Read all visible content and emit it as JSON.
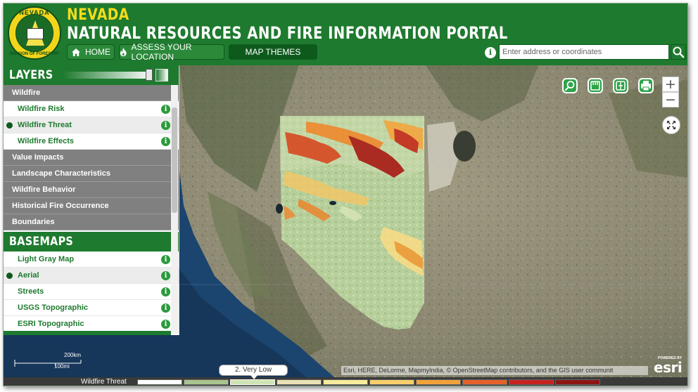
{
  "header": {
    "logo_text_top": "NEVADA",
    "logo_text_bottom": "DIVISION OF FORESTRY",
    "title_line1": "NEVADA",
    "title_line2": "NATURAL RESOURCES AND FIRE INFORMATION PORTAL"
  },
  "nav": {
    "home": {
      "label": "HOME",
      "icon": "home-icon"
    },
    "assess": {
      "label": "ASSESS YOUR LOCATION",
      "icon": "flame-icon"
    },
    "themes": {
      "label": "MAP THEMES"
    }
  },
  "search": {
    "placeholder": "Enter address or coordinates",
    "value": "",
    "info_icon": "info-icon",
    "button_icon": "search-icon"
  },
  "layers": {
    "title": "LAYERS",
    "groups": [
      {
        "label": "Wildfire",
        "items": [
          {
            "label": "Wildfire Risk",
            "selected": false
          },
          {
            "label": "Wildfire Threat",
            "selected": true
          },
          {
            "label": "Wildfire Effects",
            "selected": false
          }
        ]
      },
      {
        "label": "Value Impacts"
      },
      {
        "label": "Landscape Characteristics"
      },
      {
        "label": "Wildfire Behavior"
      },
      {
        "label": "Historical Fire Occurrence"
      },
      {
        "label": "Boundaries"
      }
    ]
  },
  "basemaps": {
    "title": "BASEMAPS",
    "items": [
      {
        "label": "Light Gray Map",
        "selected": false
      },
      {
        "label": "Aerial",
        "selected": true
      },
      {
        "label": "Streets",
        "selected": false
      },
      {
        "label": "USGS Topographic",
        "selected": false
      },
      {
        "label": "ESRI Topographic",
        "selected": false
      }
    ]
  },
  "map": {
    "zoom_in": "+",
    "zoom_out": "−",
    "scale_km": "200km",
    "scale_mi": "100mi",
    "attribution": "Esri, HERE, DeLorme, MapmyIndia, © OpenStreetMap contributors, and the GIS user communit",
    "powered_by": "POWERED BY",
    "esri_logo": "esri"
  },
  "legend": {
    "title": "Wildfire Threat",
    "tooltip": "2. Very Low",
    "colors": [
      "#ffffff",
      "#a9c58e",
      "#cfe4b4",
      "#e9e1b4",
      "#f7ec9c",
      "#f8cf6b",
      "#f2a23a",
      "#e5612a",
      "#c62220",
      "#8e1414"
    ]
  }
}
